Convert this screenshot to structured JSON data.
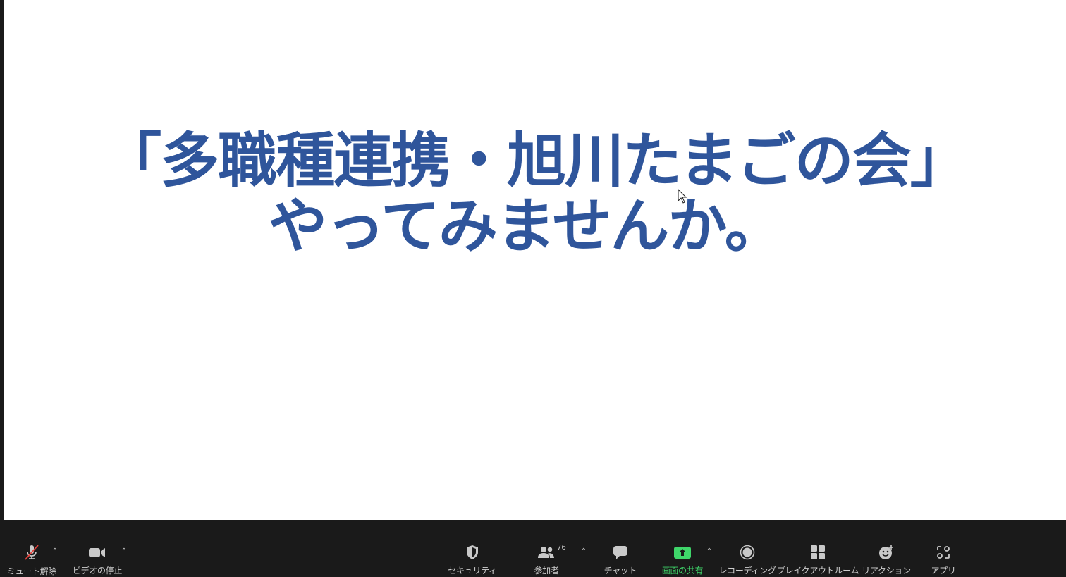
{
  "slide": {
    "line1": "「多職種連携・旭川たまごの会」",
    "line2": "やってみませんか。"
  },
  "toolbar": {
    "unmute": {
      "label": "ミュート解除",
      "icon": "mic-muted-icon"
    },
    "stop_video": {
      "label": "ビデオの停止",
      "icon": "video-camera-icon"
    },
    "security": {
      "label": "セキュリティ",
      "icon": "shield-icon"
    },
    "participants": {
      "label": "参加者",
      "count": "76",
      "icon": "people-icon"
    },
    "chat": {
      "label": "チャット",
      "icon": "chat-bubble-icon"
    },
    "share_screen": {
      "label": "画面の共有",
      "icon": "share-up-arrow-icon"
    },
    "recording": {
      "label": "レコーディング",
      "icon": "record-icon"
    },
    "breakout": {
      "label": "ブレイクアウトルーム",
      "icon": "grid-icon"
    },
    "reactions": {
      "label": "リアクション",
      "icon": "smiley-plus-icon"
    },
    "apps": {
      "label": "アプリ",
      "icon": "apps-icon"
    }
  },
  "colors": {
    "slide_text": "#2f559b",
    "share_green": "#3fd66a",
    "toolbar_bg": "#1a1a1a",
    "mute_red": "#e0403a"
  }
}
